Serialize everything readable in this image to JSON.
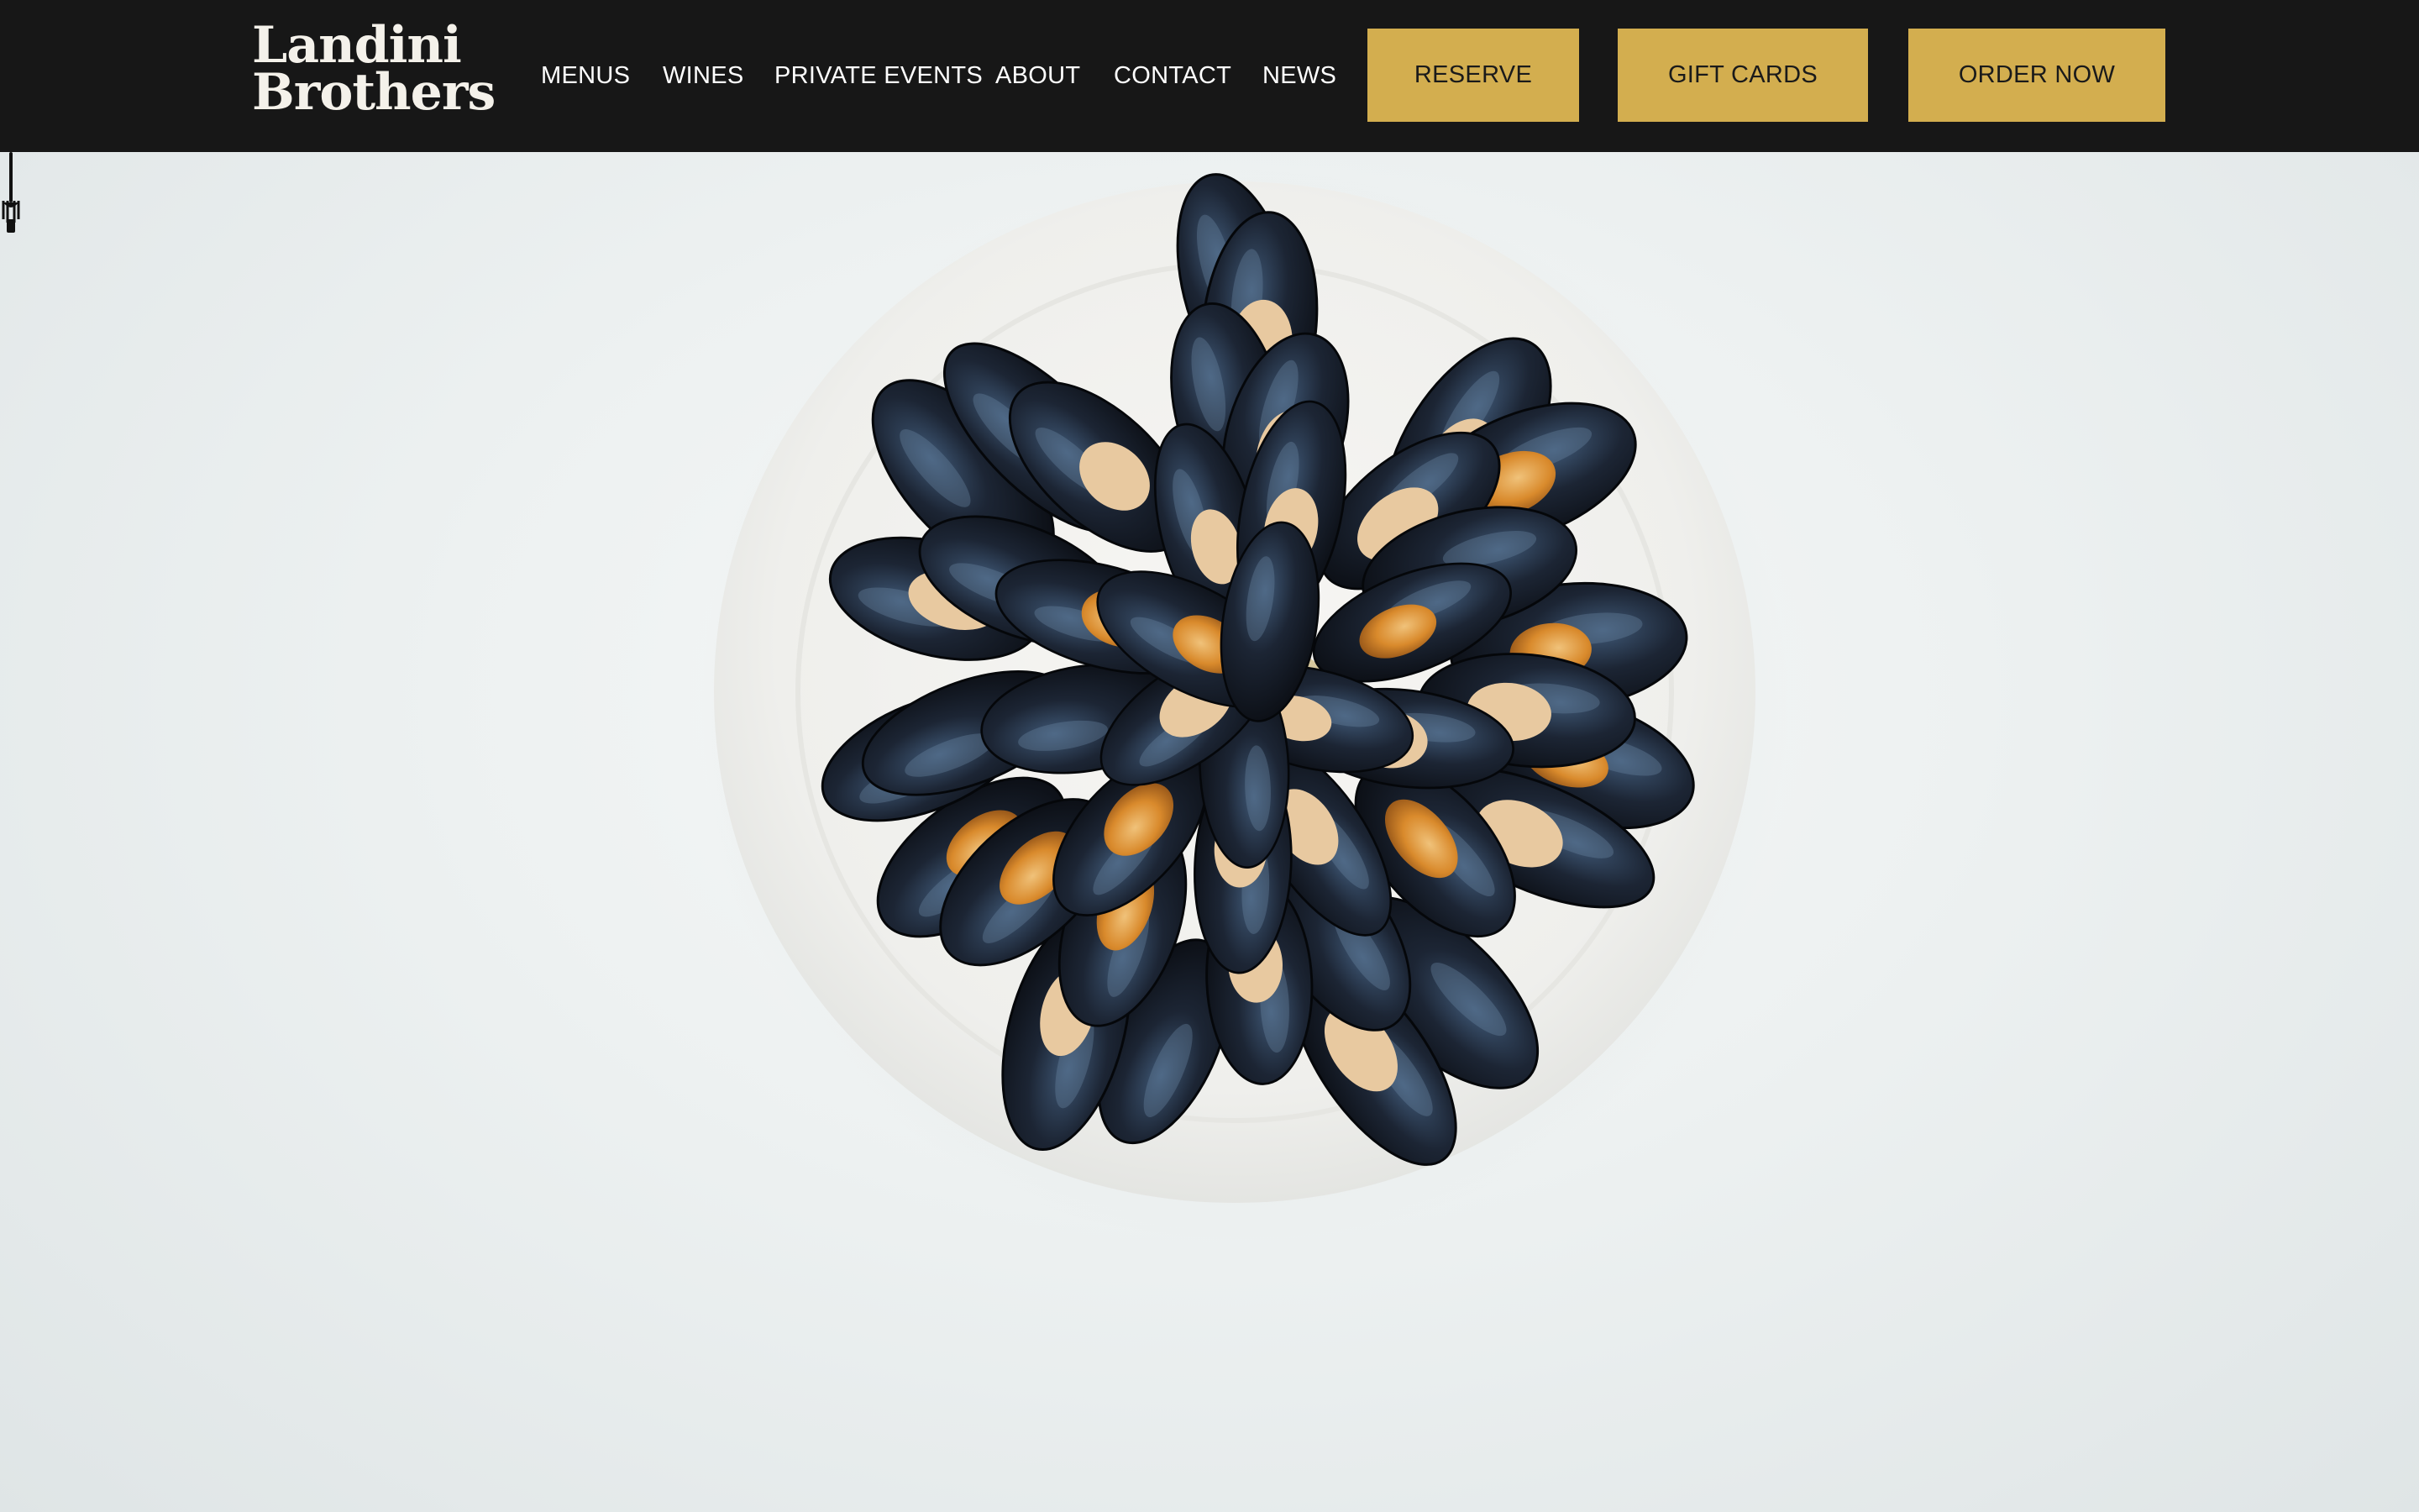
{
  "brand": {
    "name_line1": "Landini",
    "name_line2": "Brothers"
  },
  "nav": {
    "items": [
      "MENUS",
      "WINES",
      "PRIVATE EVENTS",
      "ABOUT",
      "CONTACT",
      "NEWS"
    ]
  },
  "actions": {
    "reserve": "RESERVE",
    "gift_cards": "GIFT CARDS",
    "order_now": "ORDER NOW"
  },
  "colors": {
    "header_bg": "#171717",
    "button_gold": "#d3ae4f",
    "hero_bg": "#edf1f1"
  },
  "hero": {
    "image": "plate-of-mussels",
    "scroll_icon": "fork-icon"
  }
}
